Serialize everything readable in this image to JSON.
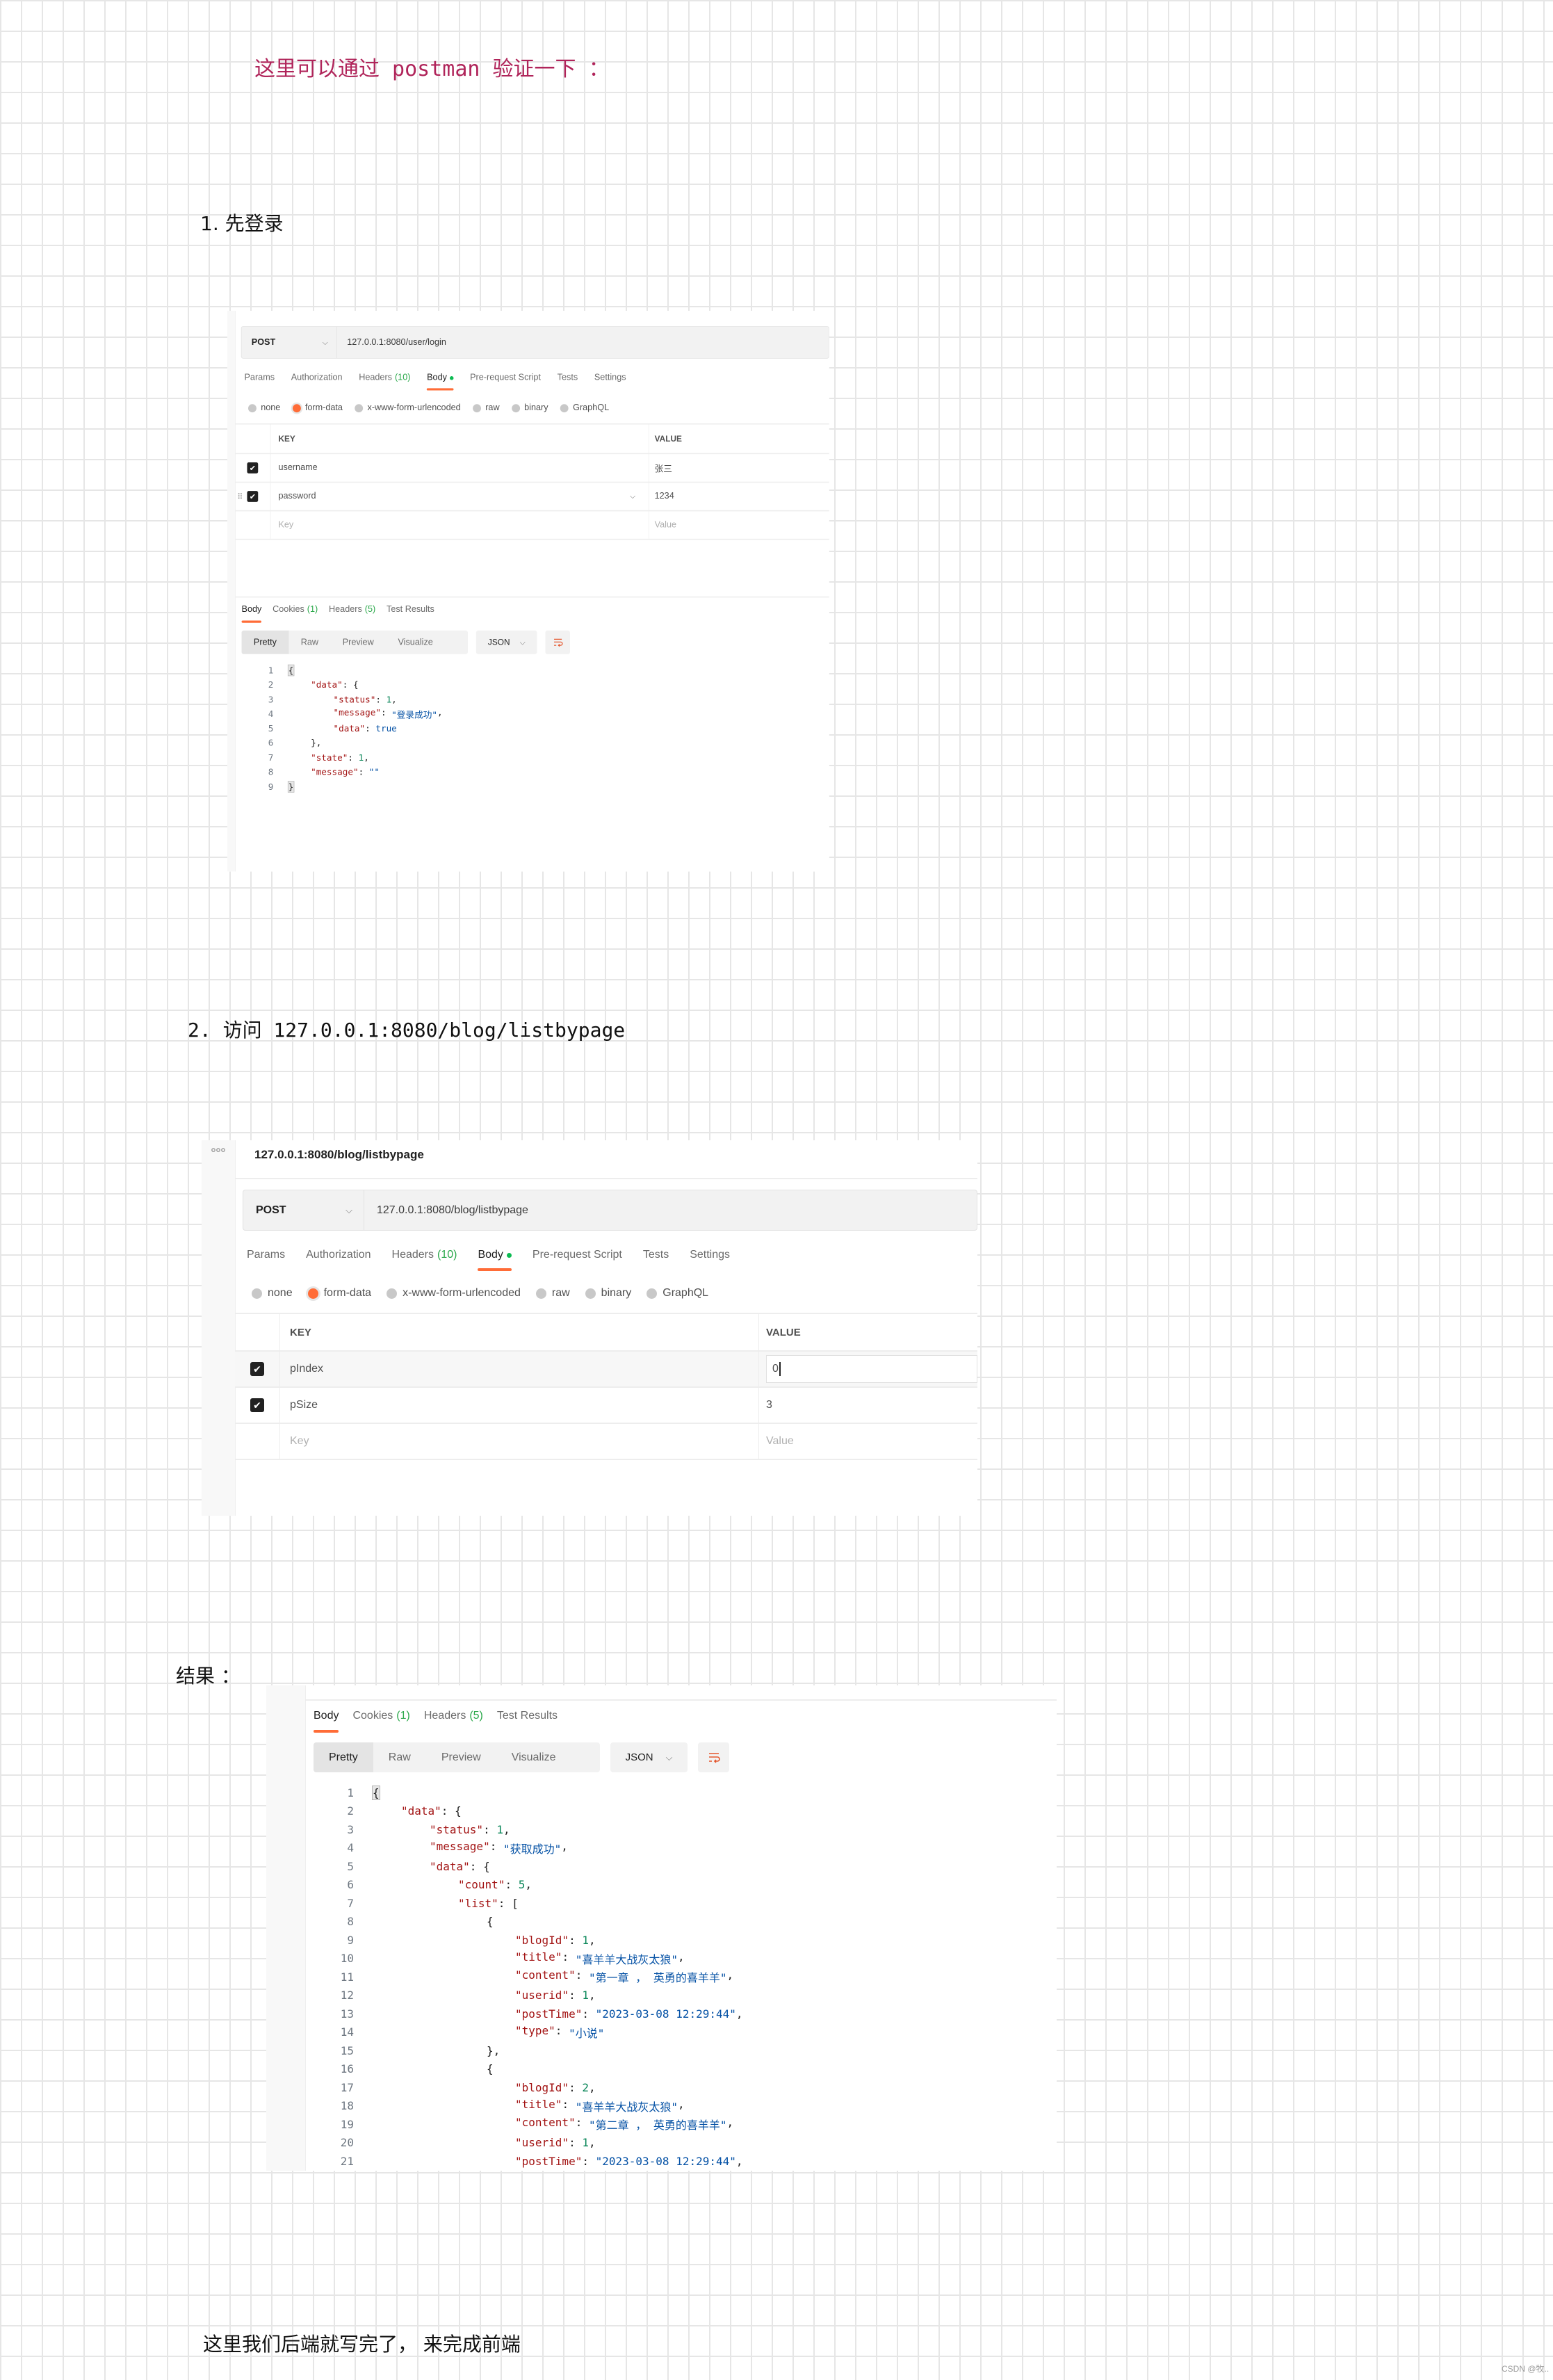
{
  "intro": "这里可以通过 postman 验证一下 ：",
  "step1": {
    "label": "1. 先登录",
    "request": {
      "method": "POST",
      "url": "127.0.0.1:8080/user/login",
      "tabs": [
        {
          "label": "Params"
        },
        {
          "label": "Authorization"
        },
        {
          "label": "Headers",
          "count": "(10)"
        },
        {
          "label": "Body"
        },
        {
          "label": "Pre-request Script"
        },
        {
          "label": "Tests"
        },
        {
          "label": "Settings"
        }
      ],
      "active_tab": "Body",
      "body_types": [
        "none",
        "form-data",
        "x-www-form-urlencoded",
        "raw",
        "binary",
        "GraphQL"
      ],
      "selected_body_type": "form-data",
      "table": {
        "headers": [
          "KEY",
          "VALUE"
        ],
        "rows": [
          {
            "checked": true,
            "key": "username",
            "value": "张三"
          },
          {
            "checked": true,
            "key": "password",
            "value": "1234",
            "hovered": true
          }
        ],
        "placeholder_key": "Key",
        "placeholder_value": "Value"
      }
    },
    "response": {
      "tabs": [
        {
          "label": "Body"
        },
        {
          "label": "Cookies",
          "count": "(1)"
        },
        {
          "label": "Headers",
          "count": "(5)"
        },
        {
          "label": "Test Results"
        }
      ],
      "active_tab": "Body",
      "view_modes": [
        "Pretty",
        "Raw",
        "Preview",
        "Visualize"
      ],
      "active_view": "Pretty",
      "format": "JSON",
      "code": [
        {
          "n": "1",
          "i": 0,
          "t": [
            [
              "bm",
              "{"
            ]
          ]
        },
        {
          "n": "2",
          "i": 1,
          "t": [
            [
              "k",
              "\"data\""
            ],
            [
              "p",
              ": {"
            ]
          ]
        },
        {
          "n": "3",
          "i": 2,
          "t": [
            [
              "k",
              "\"status\""
            ],
            [
              "p",
              ": "
            ],
            [
              "n",
              "1"
            ],
            [
              "p",
              ","
            ]
          ]
        },
        {
          "n": "4",
          "i": 2,
          "t": [
            [
              "k",
              "\"message\""
            ],
            [
              "p",
              ": "
            ],
            [
              "s",
              "\"登录成功\""
            ],
            [
              "p",
              ","
            ]
          ]
        },
        {
          "n": "5",
          "i": 2,
          "t": [
            [
              "k",
              "\"data\""
            ],
            [
              "p",
              ": "
            ],
            [
              "b",
              "true"
            ]
          ]
        },
        {
          "n": "6",
          "i": 1,
          "t": [
            [
              "p",
              "},"
            ]
          ]
        },
        {
          "n": "7",
          "i": 1,
          "t": [
            [
              "k",
              "\"state\""
            ],
            [
              "p",
              ": "
            ],
            [
              "n",
              "1"
            ],
            [
              "p",
              ","
            ]
          ]
        },
        {
          "n": "8",
          "i": 1,
          "t": [
            [
              "k",
              "\"message\""
            ],
            [
              "p",
              ": "
            ],
            [
              "s",
              "\"\""
            ]
          ]
        },
        {
          "n": "9",
          "i": 0,
          "t": [
            [
              "bm",
              "}"
            ]
          ]
        }
      ]
    }
  },
  "step2": {
    "label": "2. 访问 127.0.0.1:8080/blog/listbypage",
    "request": {
      "title": "127.0.0.1:8080/blog/listbypage",
      "method": "POST",
      "url": "127.0.0.1:8080/blog/listbypage",
      "tabs": [
        {
          "label": "Params"
        },
        {
          "label": "Authorization"
        },
        {
          "label": "Headers",
          "count": "(10)"
        },
        {
          "label": "Body"
        },
        {
          "label": "Pre-request Script"
        },
        {
          "label": "Tests"
        },
        {
          "label": "Settings"
        }
      ],
      "active_tab": "Body",
      "body_types": [
        "none",
        "form-data",
        "x-www-form-urlencoded",
        "raw",
        "binary",
        "GraphQL"
      ],
      "selected_body_type": "form-data",
      "table": {
        "headers": [
          "KEY",
          "VALUE"
        ],
        "rows": [
          {
            "checked": true,
            "key": "pIndex",
            "value": "0",
            "editing": true
          },
          {
            "checked": true,
            "key": "pSize",
            "value": "3"
          }
        ],
        "placeholder_key": "Key",
        "placeholder_value": "Value"
      }
    }
  },
  "result": {
    "label": "结果 ：",
    "response": {
      "tabs": [
        {
          "label": "Body"
        },
        {
          "label": "Cookies",
          "count": "(1)"
        },
        {
          "label": "Headers",
          "count": "(5)"
        },
        {
          "label": "Test Results"
        }
      ],
      "active_tab": "Body",
      "view_modes": [
        "Pretty",
        "Raw",
        "Preview",
        "Visualize"
      ],
      "active_view": "Pretty",
      "format": "JSON",
      "code": [
        {
          "n": "1",
          "i": 0,
          "t": [
            [
              "bm",
              "{"
            ]
          ]
        },
        {
          "n": "2",
          "i": 1,
          "t": [
            [
              "k",
              "\"data\""
            ],
            [
              "p",
              ": {"
            ]
          ]
        },
        {
          "n": "3",
          "i": 2,
          "t": [
            [
              "k",
              "\"status\""
            ],
            [
              "p",
              ": "
            ],
            [
              "n",
              "1"
            ],
            [
              "p",
              ","
            ]
          ]
        },
        {
          "n": "4",
          "i": 2,
          "t": [
            [
              "k",
              "\"message\""
            ],
            [
              "p",
              ": "
            ],
            [
              "s",
              "\"获取成功\""
            ],
            [
              "p",
              ","
            ]
          ]
        },
        {
          "n": "5",
          "i": 2,
          "t": [
            [
              "k",
              "\"data\""
            ],
            [
              "p",
              ": {"
            ]
          ]
        },
        {
          "n": "6",
          "i": 3,
          "t": [
            [
              "k",
              "\"count\""
            ],
            [
              "p",
              ": "
            ],
            [
              "n",
              "5"
            ],
            [
              "p",
              ","
            ]
          ]
        },
        {
          "n": "7",
          "i": 3,
          "t": [
            [
              "k",
              "\"list\""
            ],
            [
              "p",
              ": ["
            ]
          ]
        },
        {
          "n": "8",
          "i": 4,
          "t": [
            [
              "p",
              "{"
            ]
          ]
        },
        {
          "n": "9",
          "i": 5,
          "t": [
            [
              "k",
              "\"blogId\""
            ],
            [
              "p",
              ": "
            ],
            [
              "n",
              "1"
            ],
            [
              "p",
              ","
            ]
          ]
        },
        {
          "n": "10",
          "i": 5,
          "t": [
            [
              "k",
              "\"title\""
            ],
            [
              "p",
              ": "
            ],
            [
              "s",
              "\"喜羊羊大战灰太狼\""
            ],
            [
              "p",
              ","
            ]
          ]
        },
        {
          "n": "11",
          "i": 5,
          "t": [
            [
              "k",
              "\"content\""
            ],
            [
              "p",
              ": "
            ],
            [
              "s",
              "\"第一章 ， 英勇的喜羊羊\""
            ],
            [
              "p",
              ","
            ]
          ]
        },
        {
          "n": "12",
          "i": 5,
          "t": [
            [
              "k",
              "\"userid\""
            ],
            [
              "p",
              ": "
            ],
            [
              "n",
              "1"
            ],
            [
              "p",
              ","
            ]
          ]
        },
        {
          "n": "13",
          "i": 5,
          "t": [
            [
              "k",
              "\"postTime\""
            ],
            [
              "p",
              ": "
            ],
            [
              "s",
              "\"2023-03-08 12:29:44\""
            ],
            [
              "p",
              ","
            ]
          ]
        },
        {
          "n": "14",
          "i": 5,
          "t": [
            [
              "k",
              "\"type\""
            ],
            [
              "p",
              ": "
            ],
            [
              "s",
              "\"小说\""
            ]
          ]
        },
        {
          "n": "15",
          "i": 4,
          "t": [
            [
              "p",
              "},"
            ]
          ]
        },
        {
          "n": "16",
          "i": 4,
          "t": [
            [
              "p",
              "{"
            ]
          ]
        },
        {
          "n": "17",
          "i": 5,
          "t": [
            [
              "k",
              "\"blogId\""
            ],
            [
              "p",
              ": "
            ],
            [
              "n",
              "2"
            ],
            [
              "p",
              ","
            ]
          ]
        },
        {
          "n": "18",
          "i": 5,
          "t": [
            [
              "k",
              "\"title\""
            ],
            [
              "p",
              ": "
            ],
            [
              "s",
              "\"喜羊羊大战灰太狼\""
            ],
            [
              "p",
              ","
            ]
          ]
        },
        {
          "n": "19",
          "i": 5,
          "t": [
            [
              "k",
              "\"content\""
            ],
            [
              "p",
              ": "
            ],
            [
              "s",
              "\"第二章 ， 英勇的喜羊羊\""
            ],
            [
              "p",
              ","
            ]
          ]
        },
        {
          "n": "20",
          "i": 5,
          "t": [
            [
              "k",
              "\"userid\""
            ],
            [
              "p",
              ": "
            ],
            [
              "n",
              "1"
            ],
            [
              "p",
              ","
            ]
          ]
        },
        {
          "n": "21",
          "i": 5,
          "t": [
            [
              "k",
              "\"postTime\""
            ],
            [
              "p",
              ": "
            ],
            [
              "s",
              "\"2023-03-08 12:29:44\""
            ],
            [
              "p",
              ","
            ]
          ]
        }
      ]
    }
  },
  "footer_text": "这里我们后端就写完了， 来完成前端",
  "watermark": "CSDN @牧..",
  "colors": {
    "accent": "#ff6c37",
    "success": "#0cbb52",
    "intro_text": "#b0245a",
    "json_key": "#a31515",
    "json_string": "#0451a5",
    "json_number": "#098658"
  }
}
